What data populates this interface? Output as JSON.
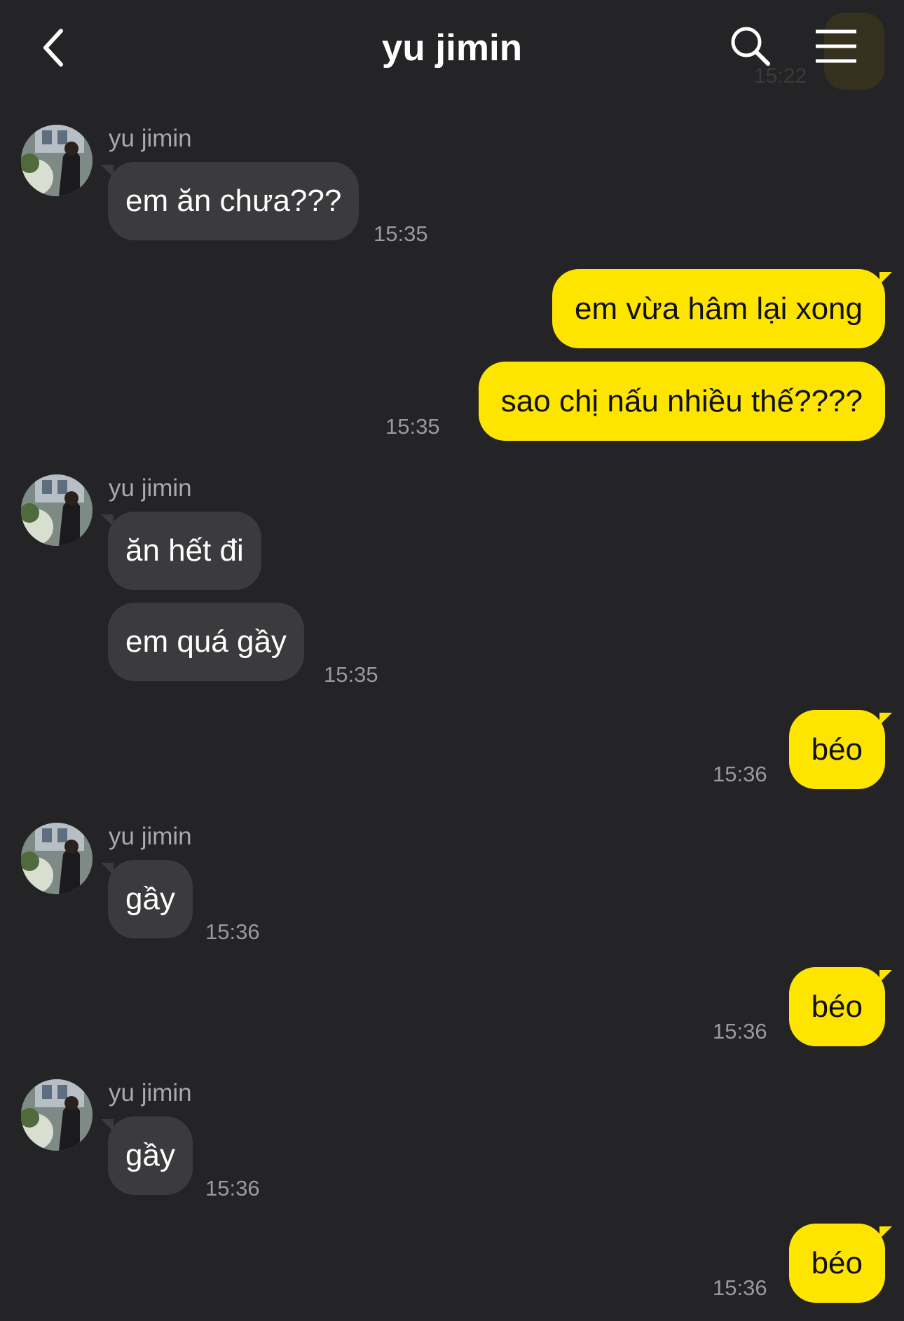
{
  "header": {
    "title": "yu jimin",
    "icons": [
      "back-icon",
      "search-icon",
      "menu-icon"
    ],
    "obscured_time": "15:22"
  },
  "colors": {
    "background": "#242426",
    "incoming": "#3b3b3e",
    "outgoing": "#fee500"
  },
  "messages": [
    {
      "sender": "yu jimin",
      "text": "em ăn chưa???",
      "time": "15:35"
    },
    {
      "text": "em vừa hâm lại xong"
    },
    {
      "text": "sao chị nấu nhiều thế????",
      "time": "15:35"
    },
    {
      "sender": "yu jimin",
      "text": "ăn hết đi"
    },
    {
      "text": "em quá gầy",
      "time": "15:35"
    },
    {
      "text": "béo",
      "time": "15:36"
    },
    {
      "sender": "yu jimin",
      "text": "gầy",
      "time": "15:36"
    },
    {
      "text": "béo",
      "time": "15:36"
    },
    {
      "sender": "yu jimin",
      "text": "gầy",
      "time": "15:36"
    },
    {
      "text": "béo",
      "time": "15:36"
    }
  ]
}
